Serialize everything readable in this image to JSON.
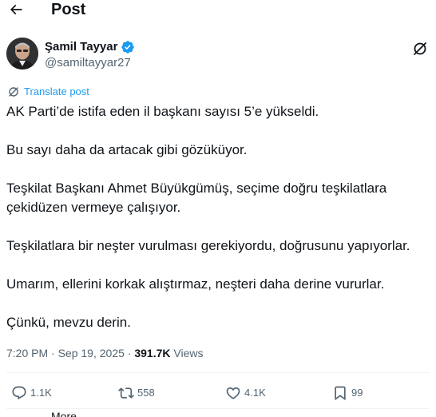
{
  "header": {
    "title": "Post",
    "back_icon": "arrow-left-icon"
  },
  "author": {
    "display_name": "Şamil Tayyar",
    "handle": "@samiltayyar27",
    "verified_color": "#1d9bf0"
  },
  "translate": {
    "label": "Translate post",
    "icon": "translate-icon"
  },
  "post": {
    "paragraphs": [
      "AK Parti’de istifa eden il başkanı sayısı 5’e yükseldi.",
      "Bu sayı daha da artacak gibi gözüküyor.",
      "Teşkilat Başkanı Ahmet Büyükgümüş, seçime doğru teşkilatlara çekidüzen vermeye çalışıyor.",
      "Teşkilatlara bir neşter vurulması gerekiyordu, doğrusunu yapıyorlar.",
      "Umarım, ellerini korkak alıştırmaz, neşteri daha derine vururlar.",
      "Çünkü, mevzu derin."
    ]
  },
  "meta": {
    "time": "7:20 PM",
    "separator": "·",
    "date": "Sep 19, 2025",
    "views_count": "391.7K",
    "views_label": "Views"
  },
  "actions": {
    "replies": "1.1K",
    "reposts": "558",
    "likes": "4.1K",
    "bookmarks": "99"
  },
  "reply_hint": {
    "text": "More"
  },
  "colors": {
    "accent": "#1d9bf0",
    "muted": "#536471",
    "text": "#0f1419"
  }
}
